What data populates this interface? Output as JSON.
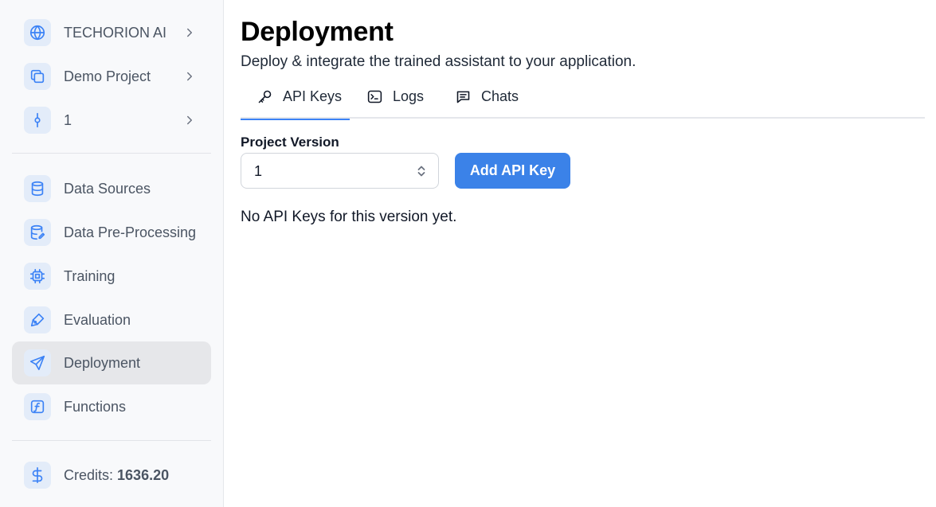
{
  "sidebar": {
    "context": [
      {
        "label": "TECHORION AI",
        "icon": "globe-icon"
      },
      {
        "label": "Demo Project",
        "icon": "copy-icon"
      },
      {
        "label": "1",
        "icon": "git-commit-icon"
      }
    ],
    "nav": [
      {
        "label": "Data Sources",
        "icon": "database-icon"
      },
      {
        "label": "Data Pre-Processing",
        "icon": "database-edit-icon"
      },
      {
        "label": "Training",
        "icon": "cpu-icon"
      },
      {
        "label": "Evaluation",
        "icon": "pen-tool-icon"
      },
      {
        "label": "Deployment",
        "icon": "send-icon",
        "active": true
      },
      {
        "label": "Functions",
        "icon": "function-icon"
      }
    ],
    "credits": {
      "label": "Credits:",
      "value": "1636.20",
      "icon": "dollar-icon"
    }
  },
  "main": {
    "title": "Deployment",
    "subtitle": "Deploy & integrate the trained assistant to your application.",
    "tabs": [
      {
        "label": "API Keys",
        "icon": "key-icon",
        "active": true
      },
      {
        "label": "Logs",
        "icon": "terminal-icon"
      },
      {
        "label": "Chats",
        "icon": "message-square-icon"
      }
    ],
    "project_version": {
      "label": "Project Version",
      "selected": "1"
    },
    "add_button": "Add API Key",
    "empty_message": "No API Keys for this version yet."
  },
  "colors": {
    "accent": "#3b82f6",
    "button": "#3b82e8",
    "sidebar_bg": "#f8f9fb",
    "active_item_bg": "#e6e7ea",
    "icon_tile_bg": "#e3ecf9"
  }
}
